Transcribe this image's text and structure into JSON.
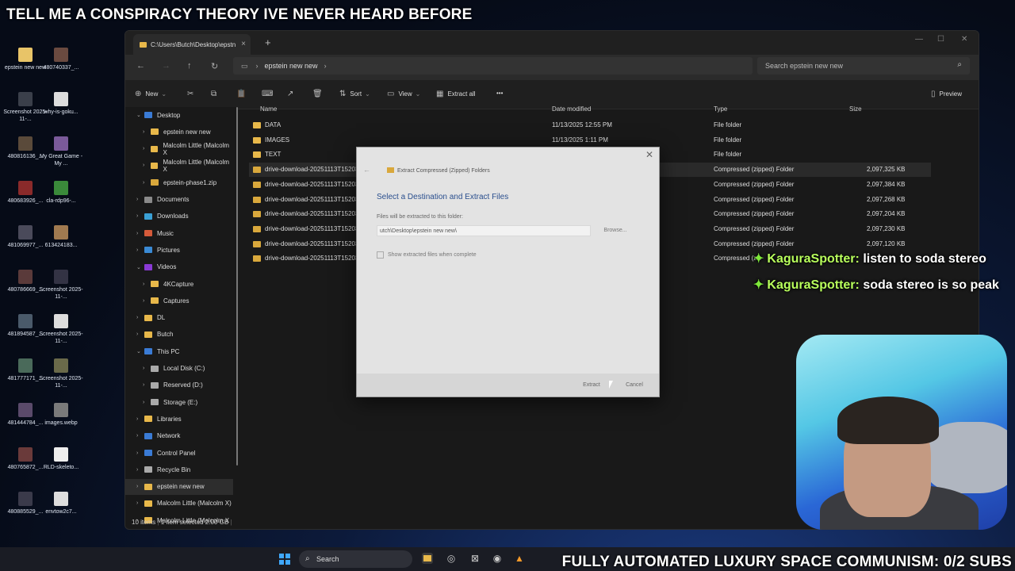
{
  "overlay": {
    "title": "TELL ME A CONSPIRACY THEORY IVE NEVER HEARD BEFORE",
    "banner": "FULLY AUTOMATED LUXURY SPACE COMMUNISM: 0/2 SUBS"
  },
  "desktop_icons": [
    {
      "label": "epstein new new",
      "color": "#e8c468"
    },
    {
      "label": "480740337_...",
      "color": "#6a4a40"
    },
    {
      "label": "Screenshot 2025-11-...",
      "color": "#3a3f4a"
    },
    {
      "label": "why-is-goku...",
      "color": "#ddd"
    },
    {
      "label": "480816136_...",
      "color": "#5a4a3a"
    },
    {
      "label": "My Great Game - My ...",
      "color": "#7a5a9a"
    },
    {
      "label": "480683926_...",
      "color": "#8a2a2a"
    },
    {
      "label": "cla-rdp96-...",
      "color": "#3a8a3a"
    },
    {
      "label": "481069977_...",
      "color": "#4a4a5a"
    },
    {
      "label": "6134241​83...",
      "color": "#a07a50"
    },
    {
      "label": "480786669_...",
      "color": "#5a3a3a"
    },
    {
      "label": "Screenshot 2025-11-...",
      "color": "#334"
    },
    {
      "label": "481894587_...",
      "color": "#4a5a6a"
    },
    {
      "label": "Screenshot 2025-11-...",
      "color": "#ddd"
    },
    {
      "label": "481777171_...",
      "color": "#4a6a5a"
    },
    {
      "label": "Screenshot 2025-11-...",
      "color": "#6a6a4a"
    },
    {
      "label": "481444784_...",
      "color": "#5a4a6a"
    },
    {
      "label": "images.webp",
      "color": "#7a7a7a"
    },
    {
      "label": "480765872_...",
      "color": "#6a3a3a"
    },
    {
      "label": "RLD-skeleto...",
      "color": "#eee"
    },
    {
      "label": "480885529_...",
      "color": "#3a3a4a"
    },
    {
      "label": "envtow2c7...",
      "color": "#ddd"
    }
  ],
  "window": {
    "tab_title": "C:\\Users\\Butch\\Desktop\\epstn",
    "address": "epstein new new",
    "search_placeholder": "Search epstein new new",
    "commands": {
      "new": "New",
      "sort": "Sort",
      "view": "View",
      "extract_all": "Extract all",
      "more": "•••",
      "preview": "Preview"
    },
    "sidebar": [
      {
        "label": "Desktop",
        "color": "#3a7bd5",
        "expanded": true,
        "indent": 0
      },
      {
        "label": "epstein new new",
        "color": "#e8b84a",
        "indent": 1
      },
      {
        "label": "Malcolm Little (Malcolm X",
        "color": "#e8b84a",
        "indent": 1
      },
      {
        "label": "Malcolm Little (Malcolm X",
        "color": "#e8b84a",
        "indent": 1
      },
      {
        "label": "epstein-phase1.zip",
        "color": "#d9a83c",
        "indent": 1
      },
      {
        "label": "Documents",
        "color": "#8a8a8a",
        "indent": 0
      },
      {
        "label": "Downloads",
        "color": "#3aa0d5",
        "indent": 0
      },
      {
        "label": "Music",
        "color": "#d55a3a",
        "indent": 0
      },
      {
        "label": "Pictures",
        "color": "#3a8ad5",
        "indent": 0
      },
      {
        "label": "Videos",
        "color": "#8a3ad5",
        "expanded": true,
        "indent": 0
      },
      {
        "label": "4KCapture",
        "color": "#e8b84a",
        "indent": 1
      },
      {
        "label": "Captures",
        "color": "#e8b84a",
        "indent": 1
      },
      {
        "label": "DL",
        "color": "#e8b84a",
        "indent": 0
      },
      {
        "label": "Butch",
        "color": "#e8b84a",
        "indent": 0
      },
      {
        "label": "This PC",
        "color": "#3a7bd5",
        "expanded": true,
        "indent": 0
      },
      {
        "label": "Local Disk (C:)",
        "color": "#aaa",
        "indent": 1
      },
      {
        "label": "Reserved (D:)",
        "color": "#aaa",
        "indent": 1
      },
      {
        "label": "Storage (E:)",
        "color": "#aaa",
        "indent": 1
      },
      {
        "label": "Libraries",
        "color": "#e8b84a",
        "indent": 0
      },
      {
        "label": "Network",
        "color": "#3a7bd5",
        "indent": 0
      },
      {
        "label": "Control Panel",
        "color": "#3a7bd5",
        "indent": 0
      },
      {
        "label": "Recycle Bin",
        "color": "#aaa",
        "indent": 0
      },
      {
        "label": "epstein new new",
        "color": "#e8b84a",
        "indent": 0,
        "selected": true
      },
      {
        "label": "Malcolm Little (Malcolm X)",
        "color": "#e8b84a",
        "indent": 0
      },
      {
        "label": "Malcolm Little (Malcolm X",
        "color": "#e8b84a",
        "indent": 0
      }
    ],
    "columns": {
      "name": "Name",
      "date": "Date modified",
      "type": "Type",
      "size": "Size"
    },
    "files": [
      {
        "name": "DATA",
        "date": "11/13/2025 12:55 PM",
        "type": "File folder",
        "size": "",
        "kind": "folder"
      },
      {
        "name": "IMAGES",
        "date": "11/13/2025 1:11 PM",
        "type": "File folder",
        "size": "",
        "kind": "folder"
      },
      {
        "name": "TEXT",
        "date": "",
        "type": "File folder",
        "size": "",
        "kind": "folder"
      },
      {
        "name": "drive-download-20251113T15203",
        "date": "",
        "type": "Compressed (zipped) Folder",
        "size": "2,097,325 KB",
        "kind": "zip",
        "highlight": true
      },
      {
        "name": "drive-download-20251113T15203",
        "date": "",
        "type": "Compressed (zipped) Folder",
        "size": "2,097,384 KB",
        "kind": "zip"
      },
      {
        "name": "drive-download-20251113T15203",
        "date": "",
        "type": "Compressed (zipped) Folder",
        "size": "2,097,268 KB",
        "kind": "zip"
      },
      {
        "name": "drive-download-20251113T15203",
        "date": "",
        "type": "Compressed (zipped) Folder",
        "size": "2,097,204 KB",
        "kind": "zip"
      },
      {
        "name": "drive-download-20251113T15203",
        "date": "",
        "type": "Compressed (zipped) Folder",
        "size": "2,097,230 KB",
        "kind": "zip"
      },
      {
        "name": "drive-download-20251113T15203",
        "date": "",
        "type": "Compressed (zipped) Folder",
        "size": "2,097,120 KB",
        "kind": "zip"
      },
      {
        "name": "drive-download-20251113T15203",
        "date": "",
        "type": "Compressed (zip",
        "size": "",
        "kind": "zip"
      }
    ],
    "status": {
      "items": "10 items",
      "selected": "1 item selected  2.00 GB"
    }
  },
  "dialog": {
    "title": "Extract Compressed (Zipped) Folders",
    "heading": "Select a Destination and Extract Files",
    "label": "Files will be extracted to this folder:",
    "path": "utch\\Desktop\\epstein new new\\",
    "browse": "Browse...",
    "checkbox": "Show extracted files when complete",
    "extract": "Extract",
    "cancel": "Cancel"
  },
  "chat": [
    {
      "user": "KaguraSpotter:",
      "message": "listen to soda stereo"
    },
    {
      "user": "KaguraSpotter:",
      "message": "soda stereo is so peak"
    }
  ],
  "taskbar": {
    "search": "Search"
  }
}
